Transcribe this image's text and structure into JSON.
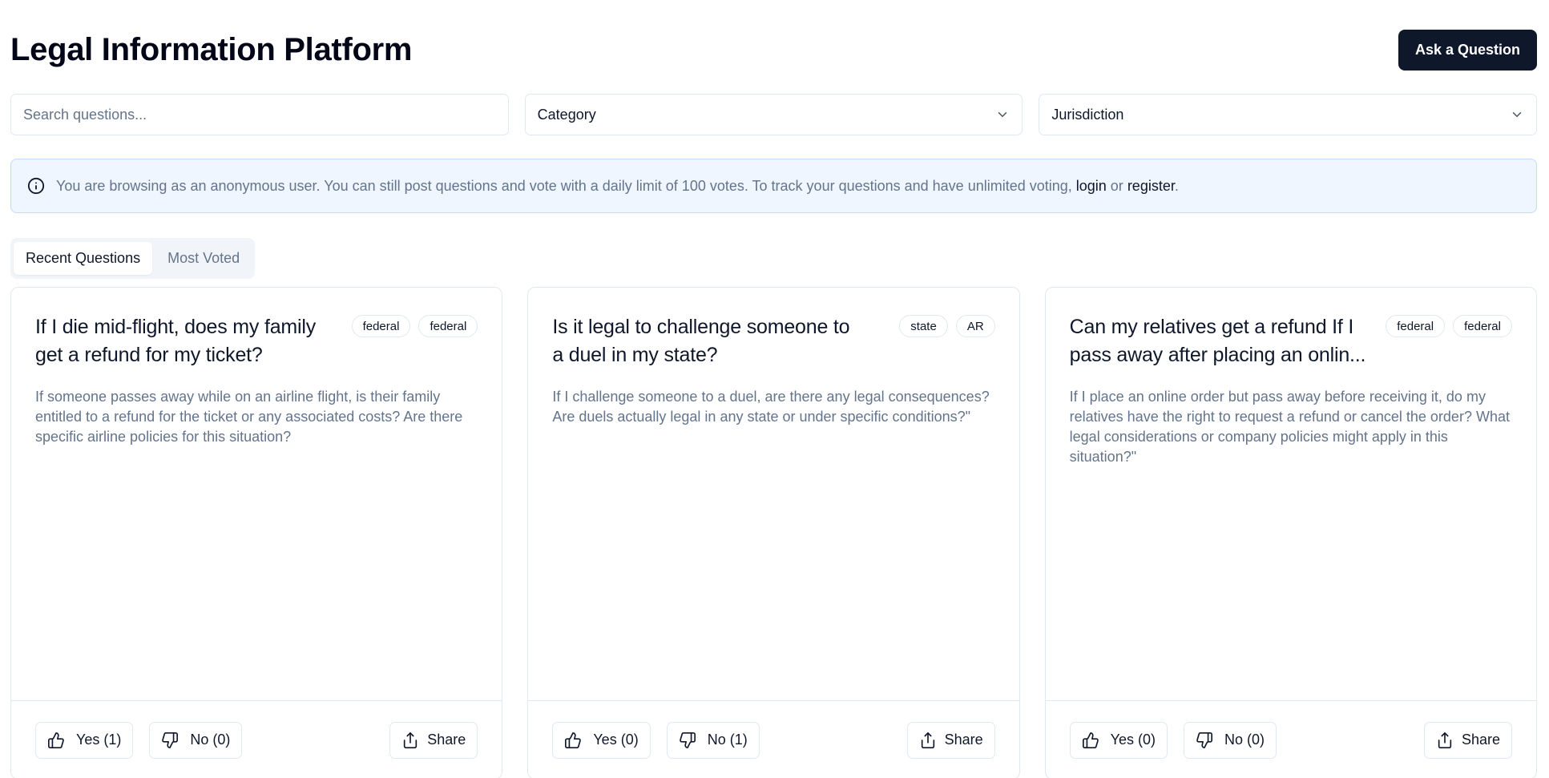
{
  "header": {
    "title": "Legal Information Platform",
    "ask_label": "Ask a Question"
  },
  "filters": {
    "search_placeholder": "Search questions...",
    "category": "Category",
    "jurisdiction": "Jurisdiction"
  },
  "notice": {
    "text": "You are browsing as an anonymous user. You can still post questions and vote with a daily limit of 100 votes. To track your questions and have unlimited voting, ",
    "login": "login",
    "or": " or ",
    "register": "register",
    "end": "."
  },
  "tabs": [
    {
      "label": "Recent Questions",
      "active": true
    },
    {
      "label": "Most Voted",
      "active": false
    }
  ],
  "cards": [
    {
      "title": "If I die mid-flight, does my family get a refund for my ticket?",
      "badges": [
        "federal",
        "federal"
      ],
      "description": "If someone passes away while on an airline flight, is their family entitled to a refund for the ticket or any associated costs? Are there specific airline policies for this situation?",
      "yes": "Yes (1)",
      "no": "No (0)",
      "share": "Share"
    },
    {
      "title": "Is it legal to challenge someone to a duel in my state?",
      "badges": [
        "state",
        "AR"
      ],
      "description": "If I challenge someone to a duel, are there any legal consequences? Are duels actually legal in any state or under specific conditions?\"",
      "yes": "Yes (0)",
      "no": "No (1)",
      "share": "Share"
    },
    {
      "title": "Can my relatives get a refund If I pass away after placing an onlin...",
      "badges": [
        "federal",
        "federal"
      ],
      "description": "If I place an online order but pass away before receiving it, do my relatives have the right to request a refund or cancel the order? What legal considerations or company policies might apply in this situation?\"",
      "yes": "Yes (0)",
      "no": "No (0)",
      "share": "Share"
    }
  ],
  "icons": {
    "thumbs_up": "thumbs-up-icon",
    "thumbs_down": "thumbs-down-icon",
    "share": "share-icon",
    "info": "info-icon",
    "chevron": "chevron-down-icon"
  }
}
